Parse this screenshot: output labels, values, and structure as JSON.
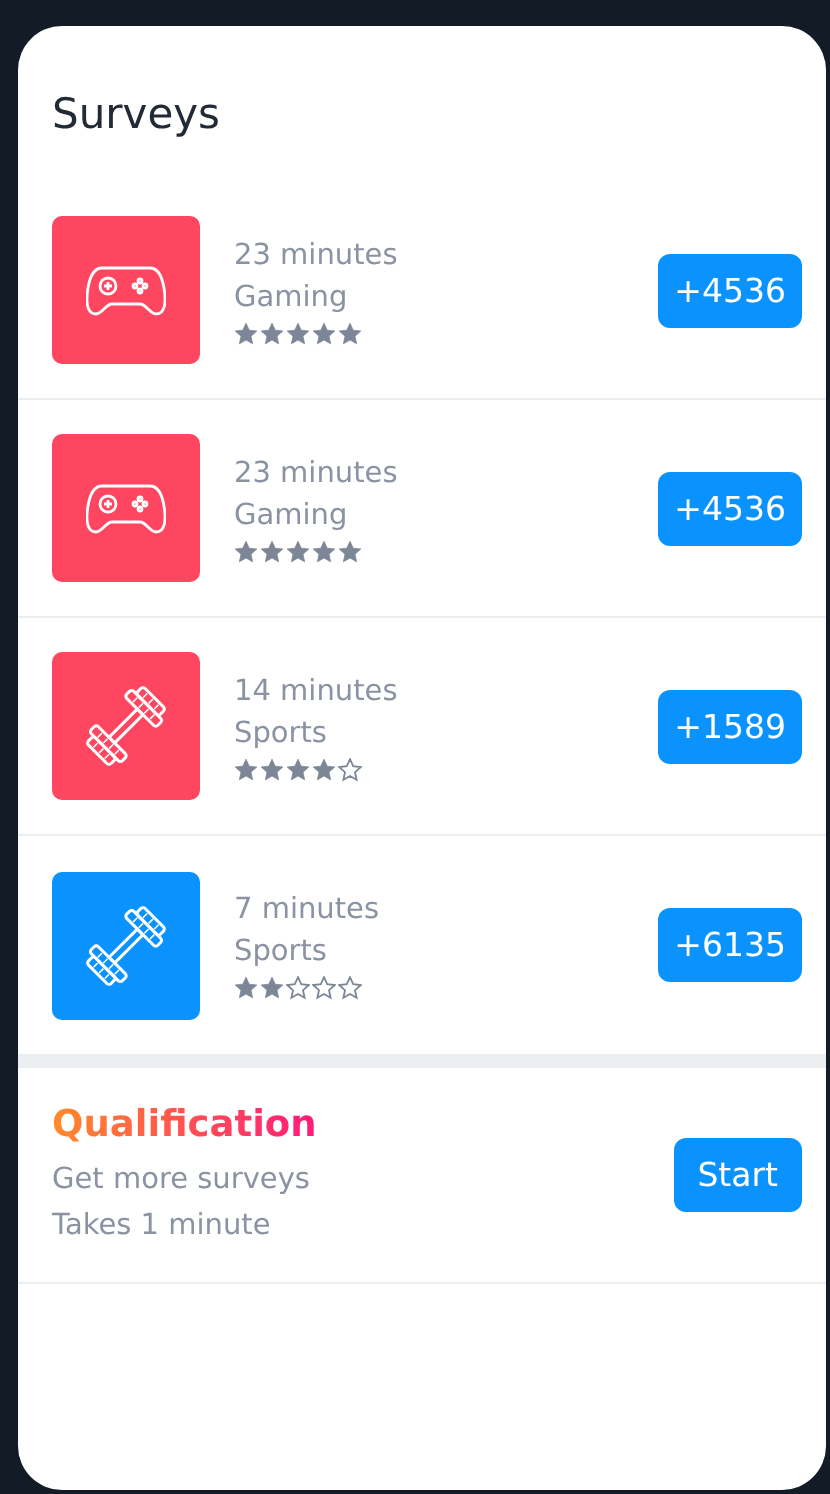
{
  "title": "Surveys",
  "surveys": [
    {
      "duration": "23 minutes",
      "category": "Gaming",
      "kind": "gamepad",
      "color": "#ff4660",
      "stars": 5,
      "reward": "+4536"
    },
    {
      "duration": "23 minutes",
      "category": "Gaming",
      "kind": "gamepad",
      "color": "#ff4660",
      "stars": 5,
      "reward": "+4536"
    },
    {
      "duration": "14 minutes",
      "category": "Sports",
      "kind": "dumbbell",
      "color": "#ff4660",
      "stars": 4,
      "reward": "+1589"
    },
    {
      "duration": "7 minutes",
      "category": "Sports",
      "kind": "dumbbell",
      "color": "#0a93ff",
      "stars": 2,
      "reward": "+6135"
    }
  ],
  "qualification": {
    "title": "Qualification",
    "lines": [
      "Get more surveys",
      "Takes 1 minute"
    ],
    "button": "Start"
  }
}
